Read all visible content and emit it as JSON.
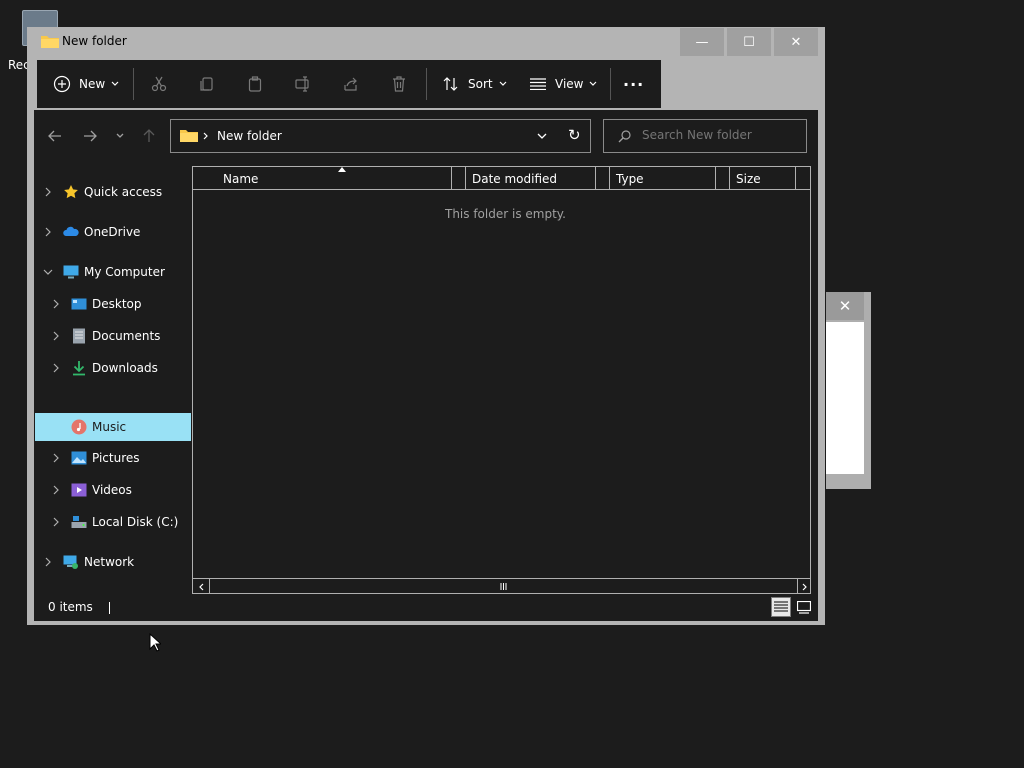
{
  "desktop": {
    "icon_label": "Rec"
  },
  "background_dialog": {
    "close_glyph": "✕"
  },
  "window": {
    "title": "New folder",
    "controls": {
      "minimize": "—",
      "maximize": "☐",
      "close": "✕"
    }
  },
  "toolbar": {
    "new_label": "New",
    "sort_label": "Sort",
    "view_label": "View",
    "more_glyph": "···"
  },
  "address": {
    "path": "New folder",
    "refresh_glyph": "↻"
  },
  "search": {
    "placeholder": "Search New folder"
  },
  "sidebar": {
    "items": [
      {
        "label": "Quick access"
      },
      {
        "label": "OneDrive"
      },
      {
        "label": "My Computer"
      },
      {
        "label": "Desktop"
      },
      {
        "label": "Documents"
      },
      {
        "label": "Downloads"
      },
      {
        "label": "Music"
      },
      {
        "label": "Pictures"
      },
      {
        "label": "Videos"
      },
      {
        "label": "Local Disk (C:)"
      },
      {
        "label": "Network"
      }
    ]
  },
  "list": {
    "columns": [
      "Name",
      "Date modified",
      "Type",
      "Size"
    ],
    "empty_message": "This folder is empty."
  },
  "status": {
    "items": "0 items"
  },
  "colors": {
    "selection": "#99e1f5",
    "pane_bg": "#1c1c1c",
    "window_frame": "#b4b4b4"
  }
}
